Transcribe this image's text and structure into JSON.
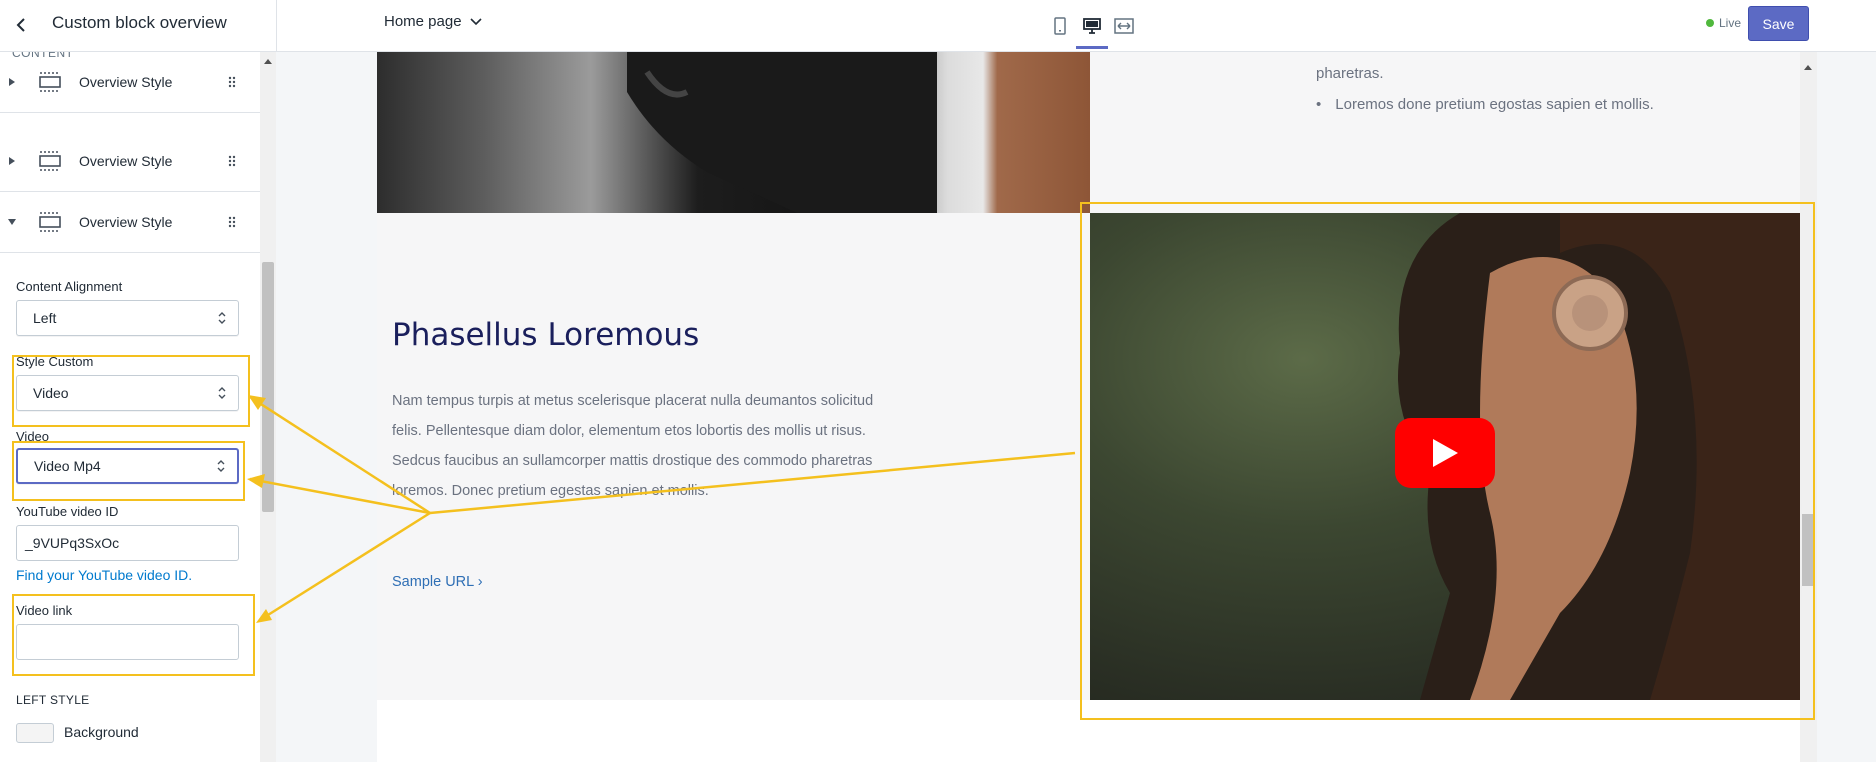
{
  "header": {
    "panel_title": "Custom block overview",
    "page_select": "Home page",
    "live_label": "Live",
    "save_label": "Save",
    "colors": {
      "accent": "#5c6ac4",
      "live": "#50b83c"
    }
  },
  "sidebar": {
    "section_label": "CONTENT",
    "blocks": [
      {
        "label": "Overview Style",
        "expanded": false
      },
      {
        "label": "Overview Style",
        "expanded": false
      },
      {
        "label": "Overview Style",
        "expanded": true
      }
    ],
    "fields": {
      "content_alignment": {
        "label": "Content Alignment",
        "value": "Left"
      },
      "style_custom": {
        "label": "Style Custom",
        "value": "Video"
      },
      "video": {
        "label": "Video",
        "value": "Video Mp4"
      },
      "youtube_id": {
        "label": "YouTube video ID",
        "value": "_9VUPq3SxOc"
      },
      "help_link": "Find your YouTube video ID.",
      "video_link": {
        "label": "Video link",
        "value": ""
      }
    },
    "left_style": {
      "heading": "LEFT STYLE",
      "background_label": "Background"
    }
  },
  "preview": {
    "top_text": "pharetras.",
    "bullet": "Loremos done pretium egostas sapien et mollis.",
    "heading": "Phasellus Loremous",
    "body": "Nam tempus turpis at metus scelerisque placerat nulla deumantos solicitud felis. Pellentesque diam dolor, elementum etos lobortis des mollis ut risus. Sedcus faucibus an sullamcorper mattis drostique des commodo pharetras loremos. Donec pretium egestas sapien et mollis.",
    "link": "Sample URL ›",
    "colors": {
      "heading": "#1a1f5c",
      "link": "#2f6fb5",
      "play": "#ff0000",
      "annotation": "#f4c01e"
    }
  }
}
